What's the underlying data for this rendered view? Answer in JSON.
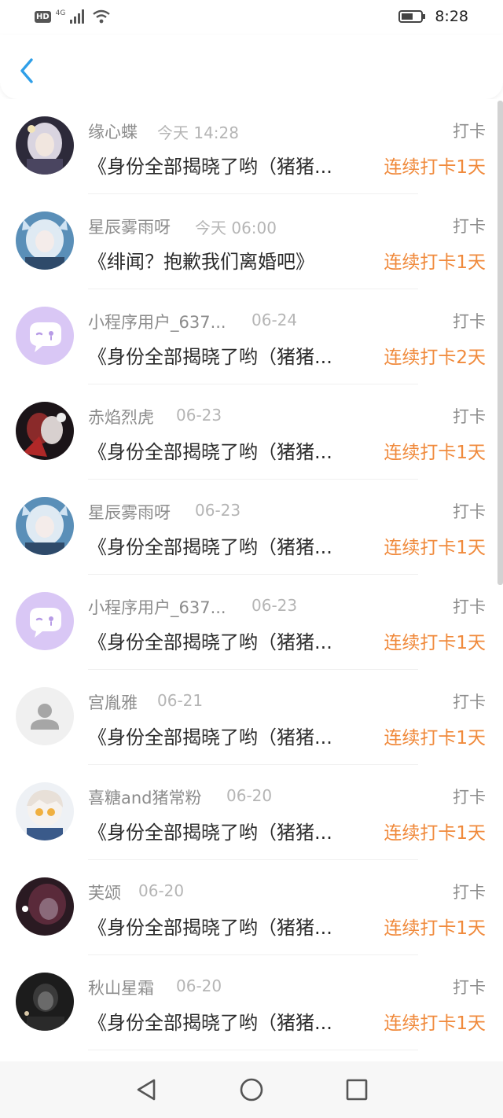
{
  "status_bar": {
    "hd_label": "HD",
    "network_type": "4G",
    "time": "8:28"
  },
  "header": {
    "back_icon": "chevron-left-icon"
  },
  "colors": {
    "accent_blue": "#2f9fe8",
    "streak_orange": "#f08a3c",
    "name_gray": "#8c8c8c",
    "time_gray": "#b5b5b5",
    "title_dark": "#2b2b2b"
  },
  "records": [
    {
      "name": "缘心蝶",
      "time": "今天 14:28",
      "kind": "打卡",
      "title": "《身份全部揭晓了哟（猪猪...",
      "streak": "连续打卡1天",
      "avatar": "anime-character-avatar"
    },
    {
      "name": "星辰雾雨呀",
      "time": "今天 06:00",
      "kind": "打卡",
      "title": "《绯闻？抱歉我们离婚吧》",
      "streak": "连续打卡1天",
      "avatar": "anime-character-avatar"
    },
    {
      "name": "小程序用户_637...",
      "time": "06-24",
      "kind": "打卡",
      "title": "《身份全部揭晓了哟（猪猪...",
      "streak": "连续打卡2天",
      "avatar": "mini-program-avatar"
    },
    {
      "name": "赤焰烈虎",
      "time": "06-23",
      "kind": "打卡",
      "title": "《身份全部揭晓了哟（猪猪...",
      "streak": "连续打卡1天",
      "avatar": "anime-character-avatar"
    },
    {
      "name": "星辰雾雨呀",
      "time": "06-23",
      "kind": "打卡",
      "title": "《身份全部揭晓了哟（猪猪...",
      "streak": "连续打卡1天",
      "avatar": "anime-character-avatar"
    },
    {
      "name": "小程序用户_637...",
      "time": "06-23",
      "kind": "打卡",
      "title": "《身份全部揭晓了哟（猪猪...",
      "streak": "连续打卡1天",
      "avatar": "mini-program-avatar"
    },
    {
      "name": "宫胤雅",
      "time": "06-21",
      "kind": "打卡",
      "title": "《身份全部揭晓了哟（猪猪...",
      "streak": "连续打卡1天",
      "avatar": "default-user-avatar"
    },
    {
      "name": "喜糖and猪常粉",
      "time": "06-20",
      "kind": "打卡",
      "title": "《身份全部揭晓了哟（猪猪...",
      "streak": "连续打卡1天",
      "avatar": "anime-character-avatar"
    },
    {
      "name": "芙颂",
      "time": "06-20",
      "kind": "打卡",
      "title": "《身份全部揭晓了哟（猪猪...",
      "streak": "连续打卡1天",
      "avatar": "anime-character-avatar"
    },
    {
      "name": "秋山星霜",
      "time": "06-20",
      "kind": "打卡",
      "title": "《身份全部揭晓了哟（猪猪...",
      "streak": "连续打卡1天",
      "avatar": "photo-avatar"
    }
  ],
  "nav_bar": {
    "back_icon": "triangle-back-icon",
    "home_icon": "circle-home-icon",
    "recents_icon": "square-recents-icon"
  }
}
